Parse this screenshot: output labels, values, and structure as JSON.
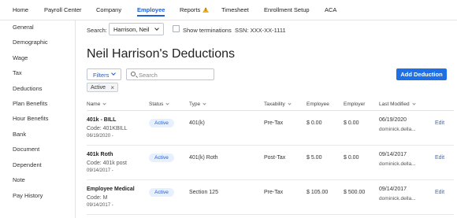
{
  "nav": {
    "items": [
      "Home",
      "Payroll Center",
      "Company",
      "Employee",
      "Reports",
      "Timesheet",
      "Enrollment Setup",
      "ACA"
    ],
    "active": "Employee"
  },
  "sidebar": {
    "items": [
      "General",
      "Demographic",
      "Wage",
      "Tax",
      "Deductions",
      "Plan Benefits",
      "Hour Benefits",
      "Bank",
      "Document",
      "Dependent",
      "Note",
      "Pay History"
    ]
  },
  "search": {
    "label": "Search:",
    "employee": "Harrison, Neil",
    "show_terminations": "Show terminations",
    "ssn": "SSN:   XXX-XX-1111"
  },
  "title": "Neil Harrison's Deductions",
  "filters": {
    "button": "Filters",
    "search_placeholder": "Search",
    "chip": "Active",
    "chip_close": "×"
  },
  "add_button": "Add Deduction",
  "table": {
    "columns": [
      "Name",
      "Status",
      "Type",
      "Taxability",
      "Employee",
      "Employer",
      "Last Modified"
    ],
    "rows": [
      {
        "name": "401k - BILL",
        "code": "Code: 401KBILL",
        "date": "06/19/2020 -",
        "status": "Active",
        "type": "401(k)",
        "taxability": "Pre-Tax",
        "employee": "$ 0.00",
        "employer": "$ 0.00",
        "last_modified": "06/19/2020",
        "modified_by": "dominick.della...",
        "edit": "Edit"
      },
      {
        "name": "401k Roth",
        "code": "Code: 401k post",
        "date": "09/14/2017 -",
        "status": "Active",
        "type": "401(k) Roth",
        "taxability": "Post-Tax",
        "employee": "$ 5.00",
        "employer": "$ 0.00",
        "last_modified": "09/14/2017",
        "modified_by": "dominick.della...",
        "edit": "Edit"
      },
      {
        "name": "Employee Medical",
        "code": "Code: M",
        "date": "09/14/2017 -",
        "status": "Active",
        "type": "Section 125",
        "taxability": "Pre-Tax",
        "employee": "$ 105.00",
        "employer": "$ 500.00",
        "last_modified": "09/14/2017",
        "modified_by": "dominick.della...",
        "edit": "Edit"
      }
    ]
  },
  "colors": {
    "accent": "#1f5fd6",
    "button": "#1f6fe5",
    "warning": "#f2b01e",
    "badge_bg": "#e6f0ff"
  }
}
